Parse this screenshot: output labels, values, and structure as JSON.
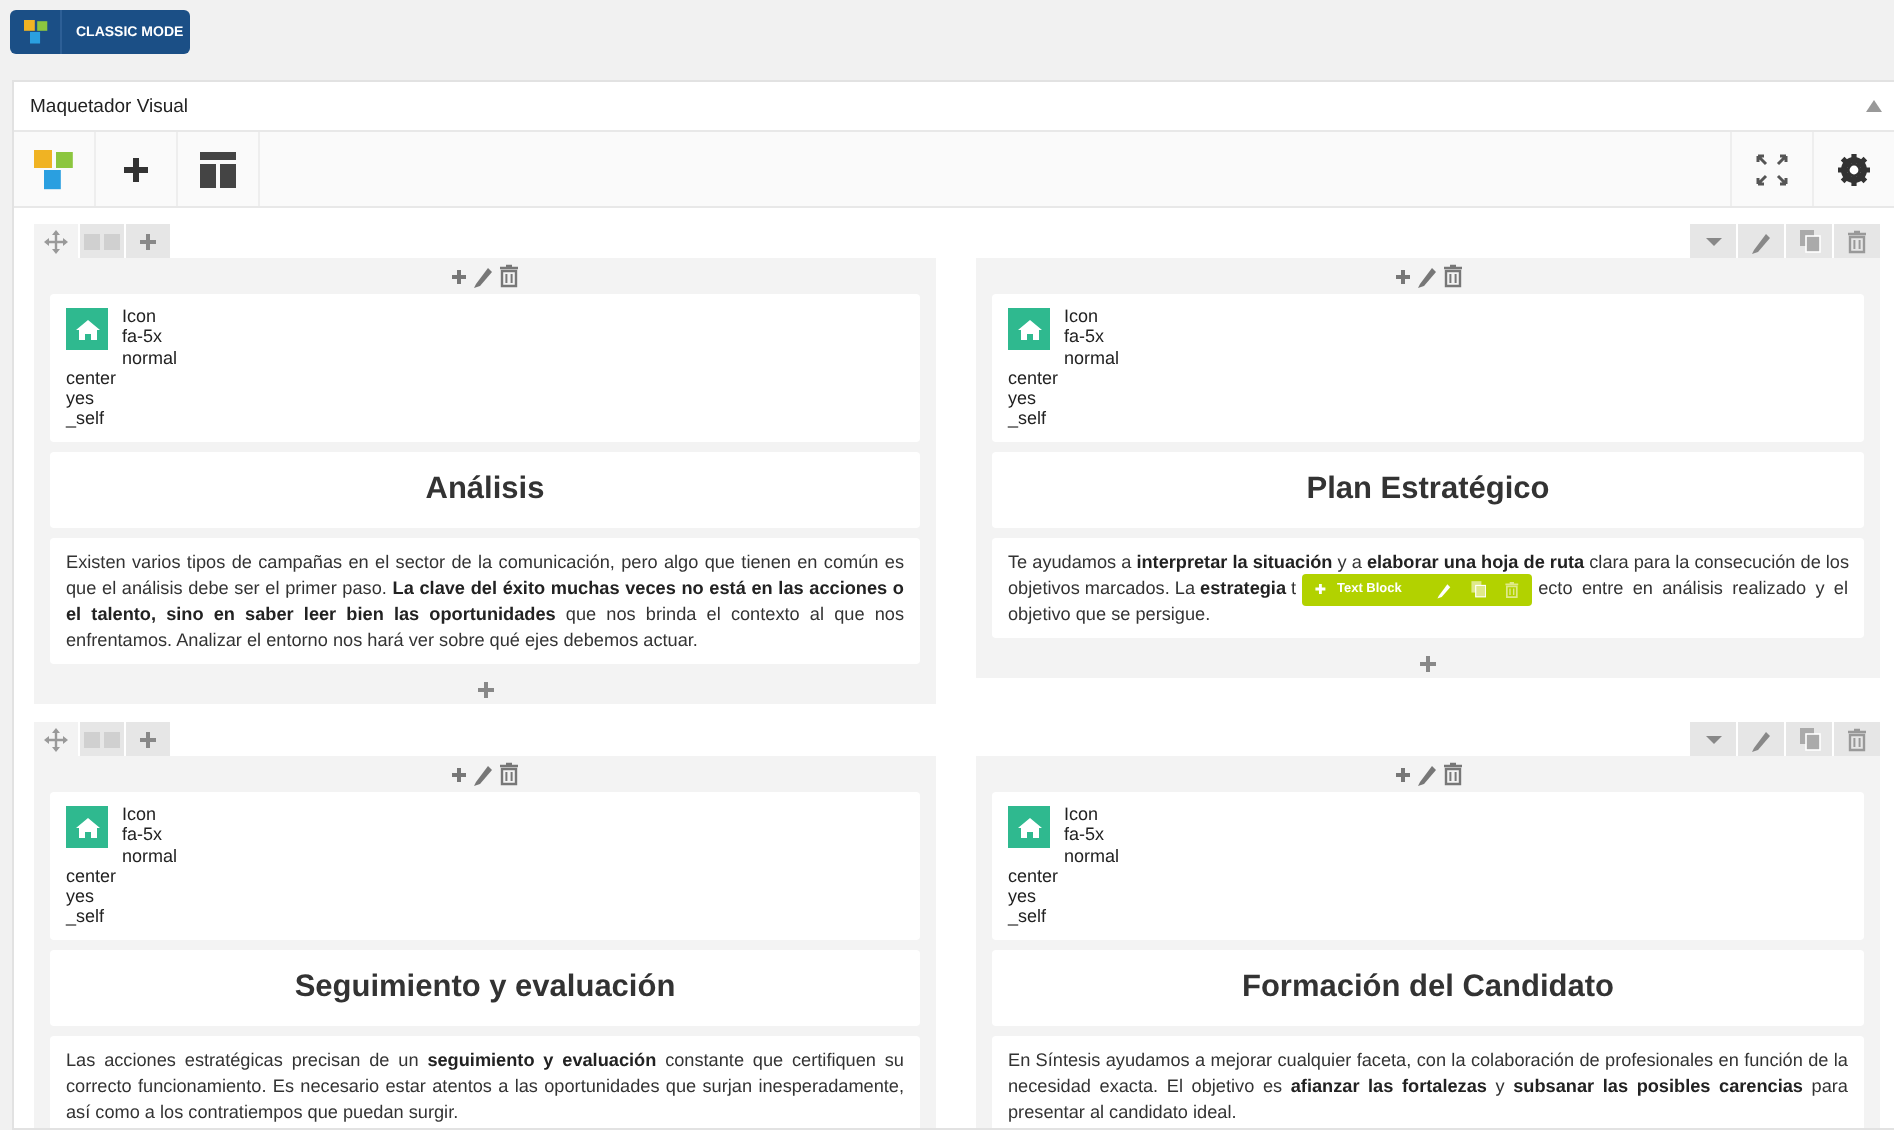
{
  "top_button": {
    "label": "CLASSIC MODE"
  },
  "panel": {
    "title": "Maquetador Visual",
    "expanded": true
  },
  "rows": [
    {
      "columns": [
        {
          "elements": [
            {
              "kind": "icon",
              "lines": [
                "Icon",
                "fa-5x",
                "normal",
                "center",
                "yes",
                "_self"
              ]
            },
            {
              "kind": "heading",
              "text": "Análisis"
            },
            {
              "kind": "text",
              "add_below": true,
              "text": "Existen varios tipos de campañas en el sector de la comunicación, pero algo que tienen en común es que el análisis debe ser el primer paso. **La clave del éxito muchas veces no está en las acciones o el talento, sino en saber leer bien las oportunidades** que nos brinda el contexto al que nos enfrentamos. Analizar el entorno nos hará ver sobre qué ejes debemos actuar."
            }
          ]
        },
        {
          "elements": [
            {
              "kind": "icon",
              "lines": [
                "Icon",
                "fa-5x",
                "normal",
                "center",
                "yes",
                "_self"
              ]
            },
            {
              "kind": "heading",
              "text": "Plan Estratégico"
            },
            {
              "kind": "text_hover",
              "add_below": true,
              "line_1": "Te ayudamos a **interpretar la situación** y a **elaborar una hoja de ruta** clara para la consecución de los",
              "line_2_before": "objetivos marcados. La **estrategia** t",
              "toolbar_label": "Text Block",
              "line_2_after": "ecto entre en análisis realizado y el",
              "line_3": "objetivo que se persigue."
            }
          ]
        }
      ]
    },
    {
      "columns": [
        {
          "elements": [
            {
              "kind": "icon",
              "lines": [
                "Icon",
                "fa-5x",
                "normal",
                "center",
                "yes",
                "_self"
              ]
            },
            {
              "kind": "heading",
              "text": "Seguimiento y evaluación"
            },
            {
              "kind": "text",
              "text": "Las acciones estratégicas precisan de un **seguimiento y evaluación** constante que certifiquen su correcto funcionamiento. Es necesario estar atentos a las oportunidades que surjan inesperadamente, así como a los contratiempos que puedan surgir."
            }
          ]
        },
        {
          "elements": [
            {
              "kind": "icon",
              "lines": [
                "Icon",
                "fa-5x",
                "normal",
                "center",
                "yes",
                "_self"
              ]
            },
            {
              "kind": "heading",
              "text": "Formación del Candidato"
            },
            {
              "kind": "text",
              "text": "En Síntesis ayudamos a mejorar cualquier faceta, con la colaboración de profesionales en función de la necesidad exacta. El objetivo es **afianzar las fortalezas** y **subsanar las posibles carencias** para presentar al candidato ideal."
            }
          ]
        }
      ]
    }
  ]
}
